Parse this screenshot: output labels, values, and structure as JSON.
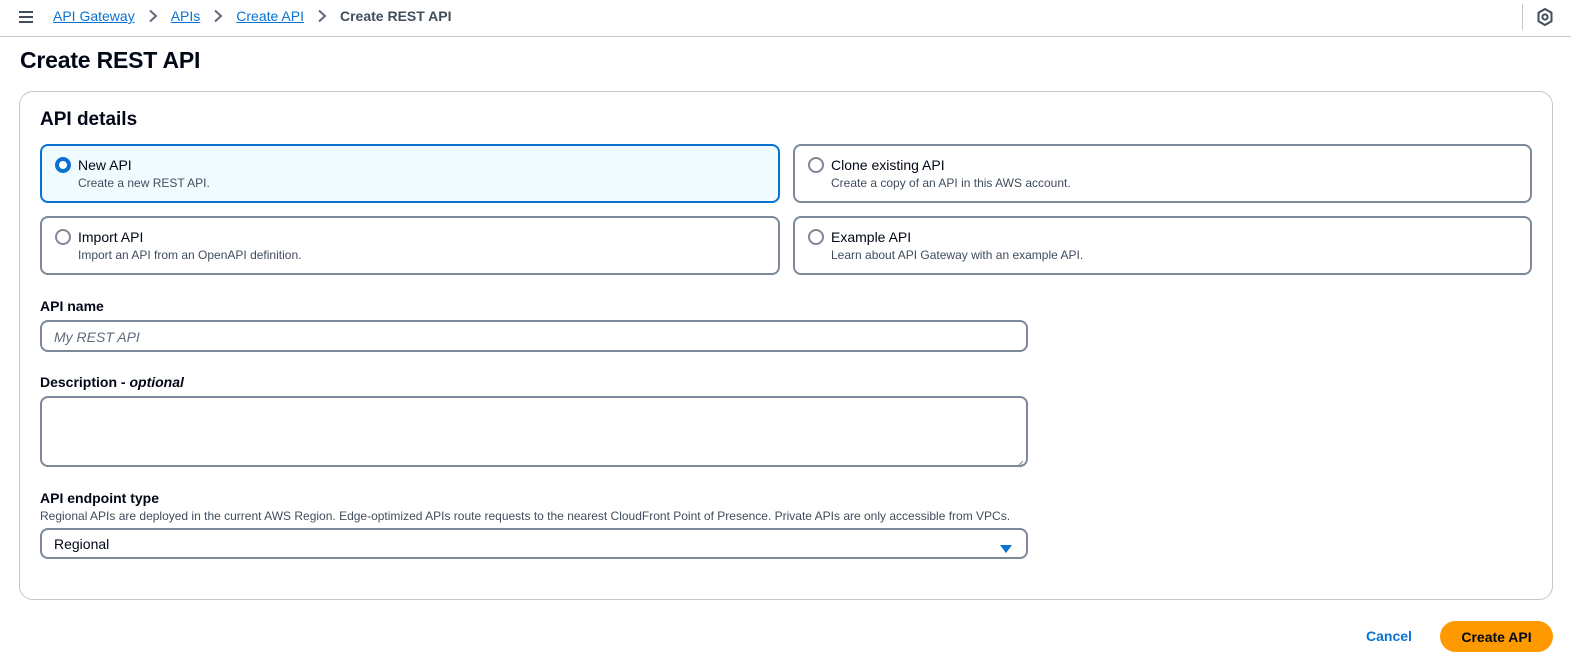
{
  "breadcrumb": {
    "items": [
      "API Gateway",
      "APIs",
      "Create API"
    ],
    "current": "Create REST API"
  },
  "page": {
    "title": "Create REST API"
  },
  "api_details": {
    "title": "API details",
    "options": [
      {
        "label": "New API",
        "description": "Create a new REST API.",
        "selected": true
      },
      {
        "label": "Clone existing API",
        "description": "Create a copy of an API in this AWS account.",
        "selected": false
      },
      {
        "label": "Import API",
        "description": "Import an API from an OpenAPI definition.",
        "selected": false
      },
      {
        "label": "Example API",
        "description": "Learn about API Gateway with an example API.",
        "selected": false
      }
    ],
    "api_name": {
      "label": "API name",
      "placeholder": "My REST API",
      "value": ""
    },
    "description": {
      "label": "Description",
      "optional_label": "optional",
      "value": ""
    },
    "endpoint_type": {
      "label": "API endpoint type",
      "hint": "Regional APIs are deployed in the current AWS Region. Edge-optimized APIs route requests to the nearest CloudFront Point of Presence. Private APIs are only accessible from VPCs.",
      "value": "Regional"
    }
  },
  "actions": {
    "cancel": "Cancel",
    "create": "Create API"
  },
  "colors": {
    "accent": "#0972d3",
    "primary_button": "#ff9900",
    "selected_tile_bg": "#f0fbff"
  }
}
